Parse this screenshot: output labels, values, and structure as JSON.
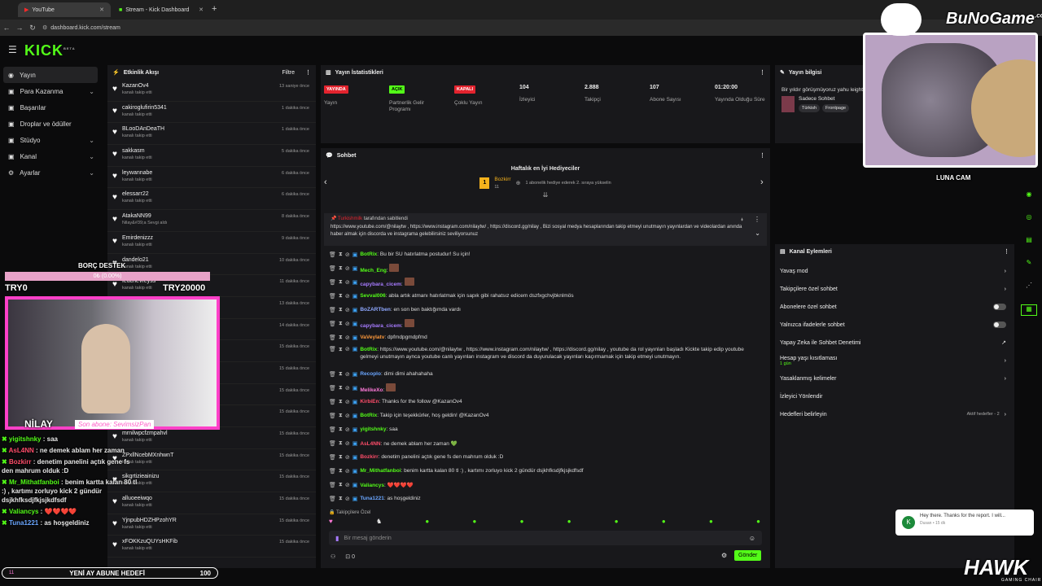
{
  "browser": {
    "tabs": [
      {
        "title": "YouTube"
      },
      {
        "title": "Stream - Kick Dashboard"
      }
    ],
    "new_tab": "+",
    "url": "dashboard.kick.com/stream"
  },
  "app": {
    "logo": "KICK",
    "logo_sub": "BETA"
  },
  "nav": {
    "items": [
      {
        "label": "Yayın",
        "icon": "video-icon"
      },
      {
        "label": "Para Kazanma",
        "chev": "⌄"
      },
      {
        "label": "Başarılar"
      },
      {
        "label": "Droplar ve ödüller"
      },
      {
        "label": "Stüdyo",
        "chev": "⌄"
      },
      {
        "label": "Kanal",
        "chev": "⌄"
      },
      {
        "label": "Ayarlar",
        "chev": "⌄"
      }
    ]
  },
  "activity": {
    "title": "Etkinlik Akışı",
    "filter": "Filtre",
    "items": [
      {
        "name": "KazanOv4",
        "sub": "kanalı takip etti",
        "time": "13 saniye önce"
      },
      {
        "name": "cakiroglufirin5341",
        "sub": "kanalı takip etti",
        "time": "1 dakika önce"
      },
      {
        "name": "BLooDAnDeaTH",
        "sub": "kanalı takip etti",
        "time": "1 dakika önce"
      },
      {
        "name": "sakkasm",
        "sub": "kanalı takip etti",
        "time": "5 dakika önce"
      },
      {
        "name": "leywannabe",
        "sub": "kanalı takip etti",
        "time": "6 dakika önce"
      },
      {
        "name": "elessarr22",
        "sub": "kanalı takip etti",
        "time": "6 dakika önce"
      },
      {
        "name": "AtakaNN99",
        "sub": "Nilay&#39;a Sevgi aldı",
        "time": "8 dakika önce"
      },
      {
        "name": "Emirdenizzz",
        "sub": "kanalı takip etti",
        "time": "9 dakika önce"
      },
      {
        "name": "dandelo21",
        "sub": "kanalı takip etti",
        "time": "10 dakika önce"
      },
      {
        "name": "feuchevreyss",
        "sub": "kanalı takip etti",
        "time": "11 dakika önce"
      },
      {
        "name": "",
        "sub": "",
        "time": "13 dakika önce"
      },
      {
        "name": "",
        "sub": "",
        "time": "14 dakika önce"
      },
      {
        "name": "",
        "sub": "",
        "time": "15 dakika önce"
      },
      {
        "name": "",
        "sub": "",
        "time": "15 dakika önce"
      },
      {
        "name": "",
        "sub": "",
        "time": "15 dakika önce"
      },
      {
        "name": "",
        "sub": "",
        "time": "15 dakika önce"
      },
      {
        "name": "mrnilwpcfzmpahvl",
        "sub": "kanalı takip etti",
        "time": "15 dakika önce"
      },
      {
        "name": "ZPxllNcebMXnhwnT",
        "sub": "kanalı takip etti",
        "time": "15 dakika önce"
      },
      {
        "name": "sikgrtizieainizu",
        "sub": "kanalı takip etti",
        "time": "15 dakika önce"
      },
      {
        "name": "alluoeeiwqo",
        "sub": "kanalı takip etti",
        "time": "15 dakika önce"
      },
      {
        "name": "YjnpubHDZHPzohYR",
        "sub": "kanalı takip etti",
        "time": "15 dakika önce"
      },
      {
        "name": "xFOKKzuQUYsHKFib",
        "sub": "kanalı takip etti",
        "time": "15 dakika önce"
      }
    ]
  },
  "stats": {
    "title": "Yayın İstatistikleri",
    "items": [
      {
        "badge": "YAYINDA",
        "badge_color": "#e3232e",
        "label": "Yayın"
      },
      {
        "badge": "AÇIK",
        "badge_color": "#53fc18",
        "label": "Partnerlik Gelir Programı"
      },
      {
        "badge": "KAPALI",
        "badge_color": "#e3232e",
        "label": "Çoklu Yayın"
      },
      {
        "value": "104",
        "label": "İzleyici"
      },
      {
        "value": "2.888",
        "label": "Takipçi"
      },
      {
        "value": "107",
        "label": "Abone Sayısı"
      },
      {
        "value": "01:20:00",
        "label": "Yayında Olduğu Süre"
      }
    ]
  },
  "info": {
    "title": "Yayın bilgisi",
    "text": "Bir yıldır görüşmüyoruz yahu leightborn !bierp",
    "category": "Sadece Sohbet",
    "tags": [
      "Türkish",
      "Frontpage"
    ]
  },
  "chat": {
    "title": "Sohbet",
    "gifters_title": "Haftalık en İyi Hediyeciler",
    "top_gifter": "Bozkirr",
    "top_gifter_count": "11",
    "gifter_note": "1 abonelik hediye ederek 2. sıraya yükselin",
    "pinned_by": "tarafından sabitlendi",
    "pinned_user": "Turkishmilk",
    "pinned_text": "https://www.youtube.com/@nilaytw , https://www.instagram.com/nilaytw/ , https://discord.gg/nilay , Bizi sosyal medya hesaplarından takip etmeyi unutmayın yayınlardan ve videolardan anında haber almak için discorda ve instagrama gelebilirsiniz seviliyorsunuz",
    "messages": [
      {
        "user": "BotRix",
        "color": "#53fc18",
        "text": "Bu bir SU hatırlatma postudur! Su için!"
      },
      {
        "user": "Mech_Eng",
        "color": "#53fc18",
        "text": "",
        "emote": true
      },
      {
        "user": "capybara_cicem",
        "color": "#a77bff",
        "text": "",
        "emote": true
      },
      {
        "user": "Sevval006",
        "color": "#53fc18",
        "text": "abla artık atmanı hatırlatmak için sapık gibi rahatsız edicem dszfxgchvjbknlmös"
      },
      {
        "user": "BoZARTben",
        "color": "#8fa8ff",
        "text": "en son ben baktığımda vardı"
      },
      {
        "user": "capybara_cicem",
        "color": "#a77bff",
        "text": "",
        "emote": true
      },
      {
        "user": "VaVeylatv",
        "color": "#ff9a3c",
        "text": "dpfmdpgmdpfmd"
      },
      {
        "user": "BotRix",
        "color": "#53fc18",
        "text": "https://www.youtube.com/@nilaytw , https://www.instagram.com/nilaytw/ , https://discord.gg/nilay , youtube da rol yayınları başladı Kickte takip edip youtube gelmeyi unutmayın aynca youtube canlı yayınları instagram ve discord da duyurulacak yayınları kaçırmamak için takip etmeyi unutmayın."
      },
      {
        "user": "Recoplo",
        "color": "#6aa6ff",
        "text": "dimi dimi ahahahaha"
      },
      {
        "user": "MelikeXo",
        "color": "#ff7ad9",
        "text": "",
        "emote": true
      },
      {
        "user": "KirbiEn",
        "color": "#ff4d6a",
        "text": "Thanks for the follow @KazanOv4"
      },
      {
        "user": "BotRix",
        "color": "#53fc18",
        "text": "Takip için teşekkürler, hoş geldin! @KazanOv4"
      },
      {
        "user": "yigitshnky",
        "color": "#53fc18",
        "text": "saa"
      },
      {
        "user": "AsL4NN",
        "color": "#ff4d6a",
        "text": "ne demek ablam her zaman 💚"
      },
      {
        "user": "Bozkirr",
        "color": "#ff4d6a",
        "text": "denetim panelini açtık gene fs den mahrum olduk :D"
      },
      {
        "user": "Mr_Mithatfanboi",
        "color": "#53fc18",
        "text": "benim kartta kalan 80 tl :) , kartımı zorluyo kick 2 gündür dsjkhfksdjfkjsjkdfsdf"
      },
      {
        "user": "Valiancys",
        "color": "#53fc18",
        "text": "❤️❤️❤️❤️"
      },
      {
        "user": "Tuna1221",
        "color": "#6aa6ff",
        "text": "as hoşgeldiniz"
      }
    ],
    "followers_only": "Takipçilere Özel",
    "input_placeholder": "Bir mesaj gönderin",
    "send": "Gönder",
    "counter": "0"
  },
  "actions": {
    "title": "Kanal Eylemleri",
    "items": [
      {
        "label": "Yavaş mod",
        "type": "chevron"
      },
      {
        "label": "Takipçilere özel sohbet",
        "type": "chevron"
      },
      {
        "label": "Abonelere özel sohbet",
        "type": "toggle"
      },
      {
        "label": "Yalnızca ifadelerle sohbet",
        "type": "toggle"
      },
      {
        "label": "Yapay Zeka ile Sohbet Denetimi",
        "type": "ext"
      },
      {
        "label": "Hesap yaşı kısıtlaması",
        "sub": "1 gün",
        "type": "chevron"
      },
      {
        "label": "Yasaklanmış kelimeler",
        "type": "chevron"
      },
      {
        "label": "İzleyici Yönlendir",
        "type": "none"
      },
      {
        "label": "Hedefleri belirleyin",
        "extra": "Aktif hedefler - 2",
        "type": "chevron"
      }
    ]
  },
  "toast": {
    "text": "Hey there. Thanks for the report. I will...",
    "sub": "Dusan • 15 dk"
  },
  "overlay": {
    "debt_title": "BORÇ DESTEK",
    "debt_progress": "0₺ (0.00%)",
    "debt_progress_fraction": 0.0,
    "debt_left": "TRY0",
    "debt_right": "TRY20000",
    "streamer": "NİLAY",
    "last_sub": "Son abone: SevimsizPan",
    "cam_label": "LUNA CAM",
    "brand": "BuNoGame",
    "brand_sub": ".com",
    "hawk": "HAWK",
    "hawk_sub": "GAMING CHAIR",
    "goal": "YENİ AY ABUNE HEDEFİ",
    "goal_value": "100",
    "goal_left": "11",
    "chat": [
      {
        "user": "yigitshnky",
        "color": "#53fc18",
        "text": "saa"
      },
      {
        "user": "AsL4NN",
        "color": "#ff4d6a",
        "text": "ne demek ablam her zaman"
      },
      {
        "user": "Bozkirr",
        "color": "#ff4d6a",
        "text": "denetim panelini açtık gene fs den mahrum olduk :D"
      },
      {
        "user": "Mr_Mithatfanboi",
        "color": "#53fc18",
        "text": "benim kartta kalan 80 tl :) , kartımı zorluyo kick 2 gündür dsjkhfksdjfkjsjkdfsdf"
      },
      {
        "user": "Valiancys",
        "color": "#53fc18",
        "text": "❤️❤️❤️❤️"
      },
      {
        "user": "Tuna1221",
        "color": "#6aa6ff",
        "text": "as hoşgeldiniz"
      }
    ]
  }
}
